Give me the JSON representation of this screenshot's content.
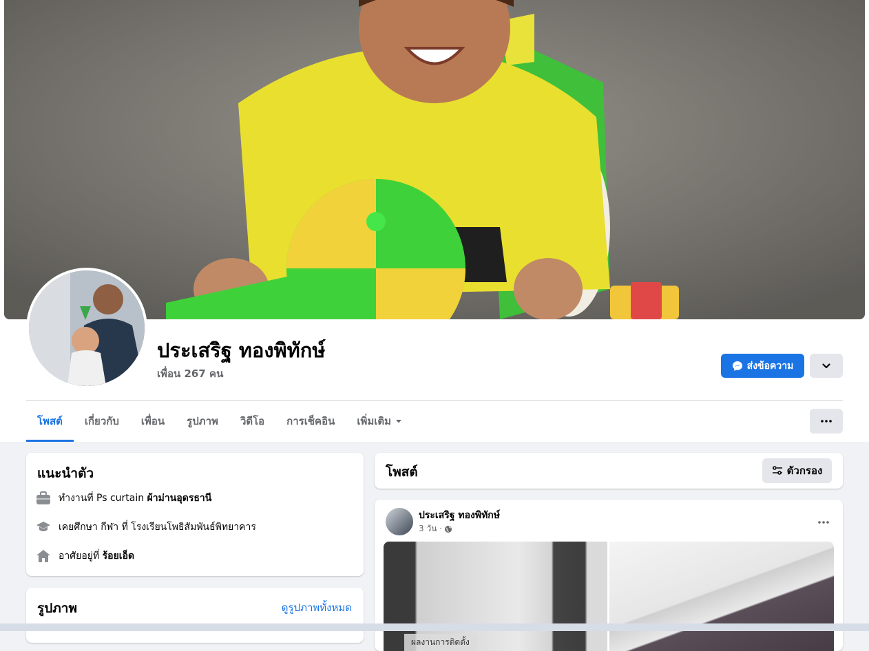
{
  "profile": {
    "name": "ประเสริฐ ทองพิทักษ์",
    "friends": "เพื่อน 267 คน"
  },
  "actions": {
    "message_label": "ส่งข้อความ"
  },
  "tabs": [
    {
      "label": "โพสต์"
    },
    {
      "label": "เกี่ยวกับ"
    },
    {
      "label": "เพื่อน"
    },
    {
      "label": "รูปภาพ"
    },
    {
      "label": "วิดีโอ"
    },
    {
      "label": "การเช็คอิน"
    },
    {
      "label": "เพิ่มเติม"
    }
  ],
  "intro": {
    "title": "แนะนำตัว",
    "work_prefix": "ทำงานที่ Ps curtain ",
    "work_place": "ผ้าม่านอุดรธานี",
    "education": "เคยศึกษา กีฬา ที่ โรงเรียนโพธิสัมพันธ์พิทยาคาร",
    "lives_prefix": "อาศัยอยู่ที่ ",
    "lives_place": "ร้อยเอ็ด"
  },
  "photos": {
    "title": "รูปภาพ",
    "see_all": "ดูรูปภาพทั้งหมด"
  },
  "posts_header": {
    "title": "โพสต์",
    "filter_label": "ตัวกรอง"
  },
  "post": {
    "author": "ประเสริฐ ทองพิทักษ์",
    "time": "3 วัน ·",
    "image_label": "ผลงานการติดตั้ง"
  },
  "colors": {
    "accent": "#1b74e4",
    "background": "#f0f2f5"
  }
}
